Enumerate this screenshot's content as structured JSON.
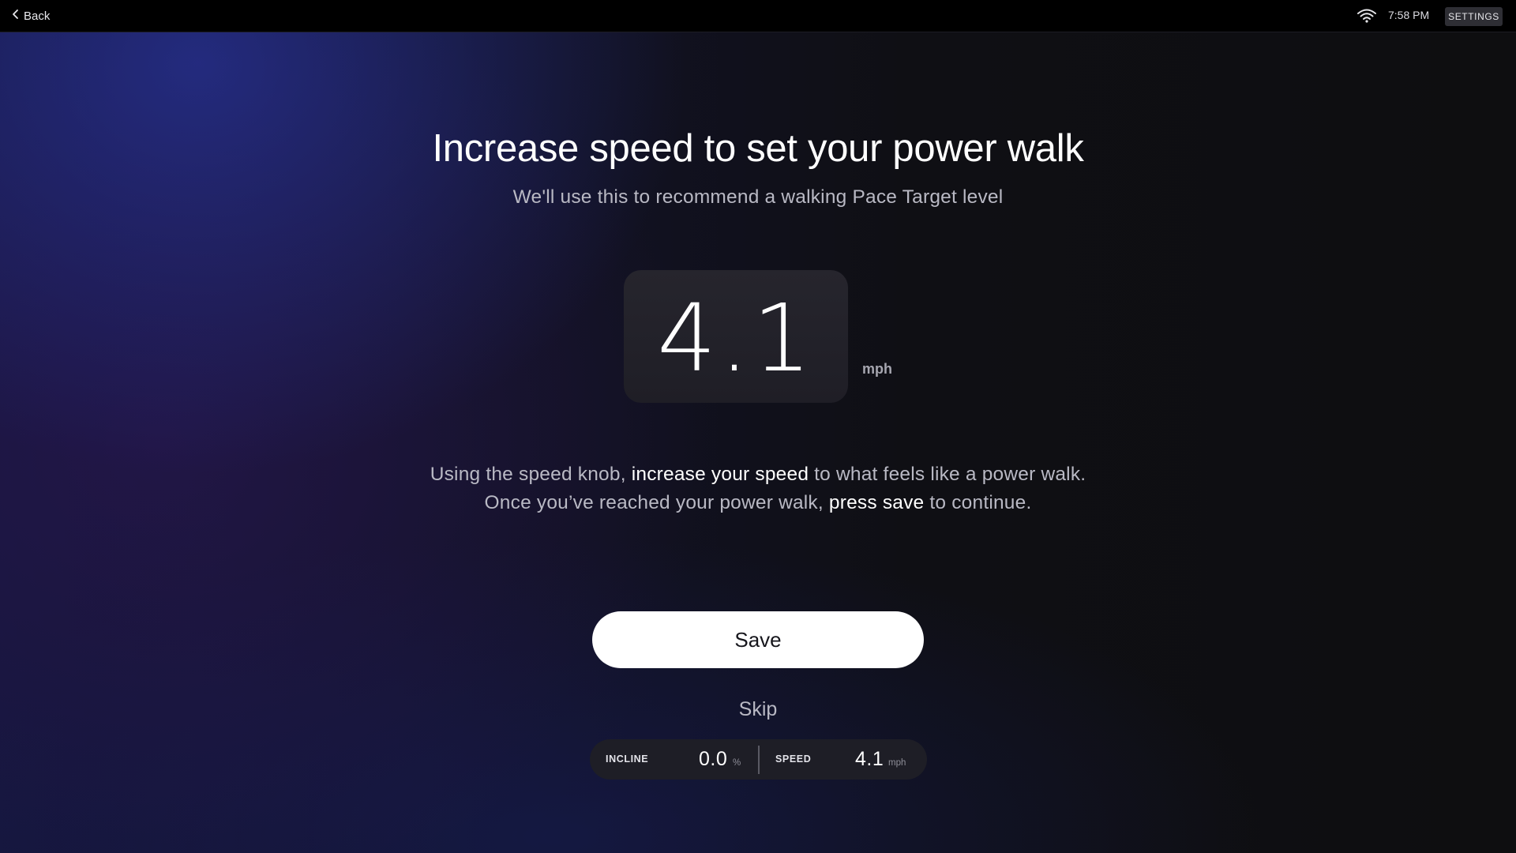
{
  "topbar": {
    "back_label": "Back",
    "time": "7:58 PM",
    "settings_label": "SETTINGS",
    "wifi_icon": "wifi-icon",
    "back_icon": "chevron-left-icon"
  },
  "main": {
    "title": "Increase speed to set your power walk",
    "subtitle": "We'll use this to recommend a walking Pace Target level",
    "speed_value": "4.1",
    "speed_unit": "mph",
    "instructions": {
      "line1_pre": "Using the speed knob, ",
      "line1_highlight": "increase your speed",
      "line1_post": " to what feels like a power walk.",
      "line2_pre": "Once you’ve reached your power walk, ",
      "line2_highlight": "press save",
      "line2_post": " to continue."
    },
    "save_label": "Save",
    "skip_label": "Skip"
  },
  "metrics": {
    "incline_label": "INCLINE",
    "incline_value": "0.0",
    "incline_unit": "%",
    "speed_label": "SPEED",
    "speed_value": "4.1",
    "speed_unit": "mph"
  },
  "colors": {
    "background": "#0e0e10",
    "accent_gradient": "#283296",
    "button": "#ffffff",
    "text_secondary": "#b9b9c4"
  }
}
